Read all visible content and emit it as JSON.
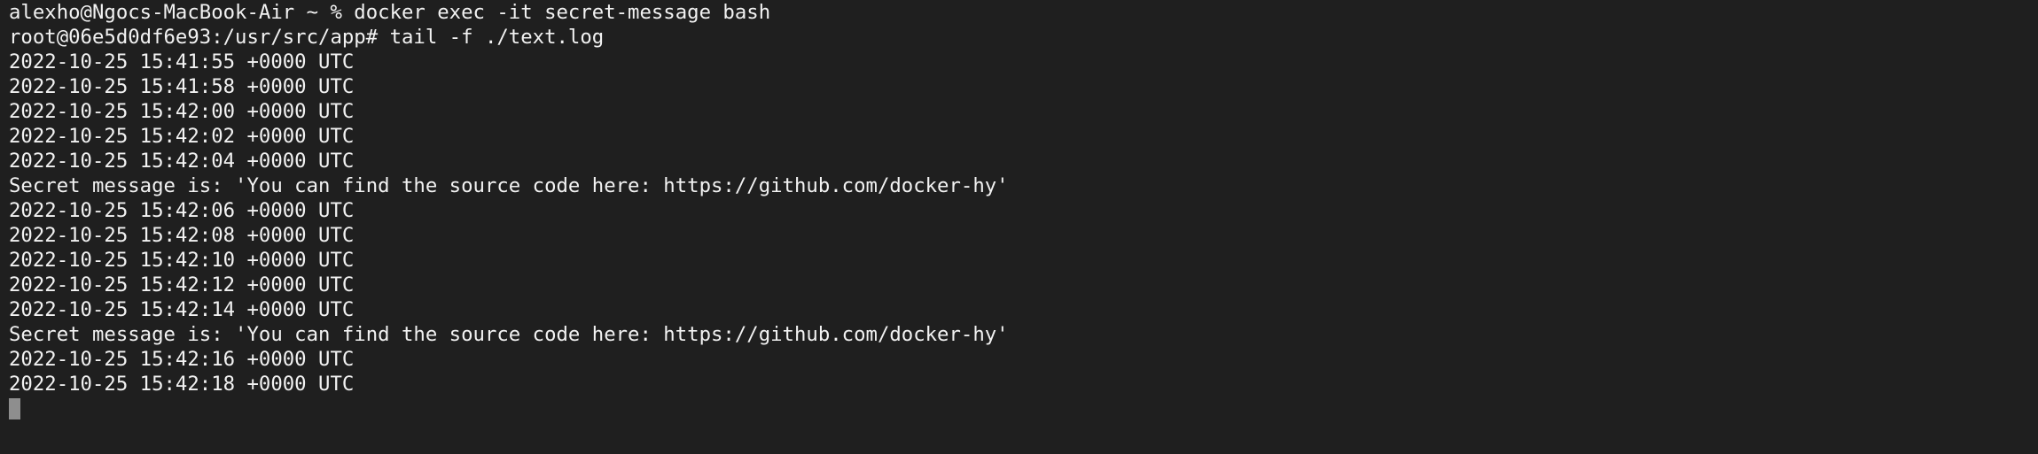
{
  "terminal": {
    "lines": [
      "alexho@Ngocs-MacBook-Air ~ % docker exec -it secret-message bash",
      "root@06e5d0df6e93:/usr/src/app# tail -f ./text.log",
      "2022-10-25 15:41:55 +0000 UTC",
      "2022-10-25 15:41:58 +0000 UTC",
      "2022-10-25 15:42:00 +0000 UTC",
      "2022-10-25 15:42:02 +0000 UTC",
      "2022-10-25 15:42:04 +0000 UTC",
      "Secret message is: 'You can find the source code here: https://github.com/docker-hy'",
      "2022-10-25 15:42:06 +0000 UTC",
      "2022-10-25 15:42:08 +0000 UTC",
      "2022-10-25 15:42:10 +0000 UTC",
      "2022-10-25 15:42:12 +0000 UTC",
      "2022-10-25 15:42:14 +0000 UTC",
      "Secret message is: 'You can find the source code here: https://github.com/docker-hy'",
      "2022-10-25 15:42:16 +0000 UTC",
      "2022-10-25 15:42:18 +0000 UTC"
    ]
  },
  "colors": {
    "background": "#1f1f1f",
    "foreground": "#f2f2f2",
    "cursor": "#8e8e8e"
  }
}
